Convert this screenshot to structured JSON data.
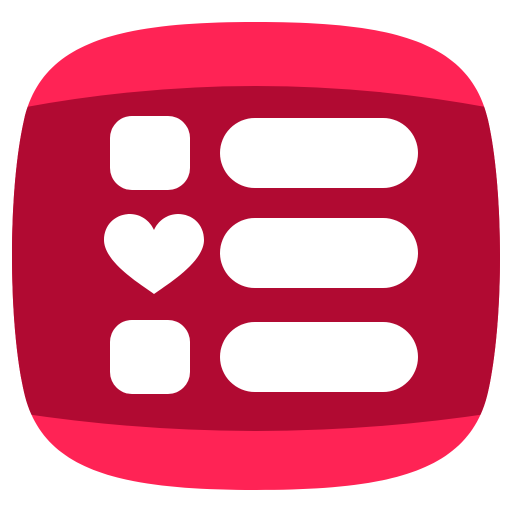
{
  "icon": {
    "name": "wish-list-app-icon",
    "colors": {
      "outer": "#FF2355",
      "band": "#B10A32",
      "glyph": "#FFFFFF",
      "background": "#FFFFFF"
    },
    "rows": [
      {
        "marker": "rounded-square-icon",
        "bar": "list-bar"
      },
      {
        "marker": "heart-icon",
        "bar": "list-bar"
      },
      {
        "marker": "rounded-square-icon",
        "bar": "list-bar"
      }
    ]
  }
}
